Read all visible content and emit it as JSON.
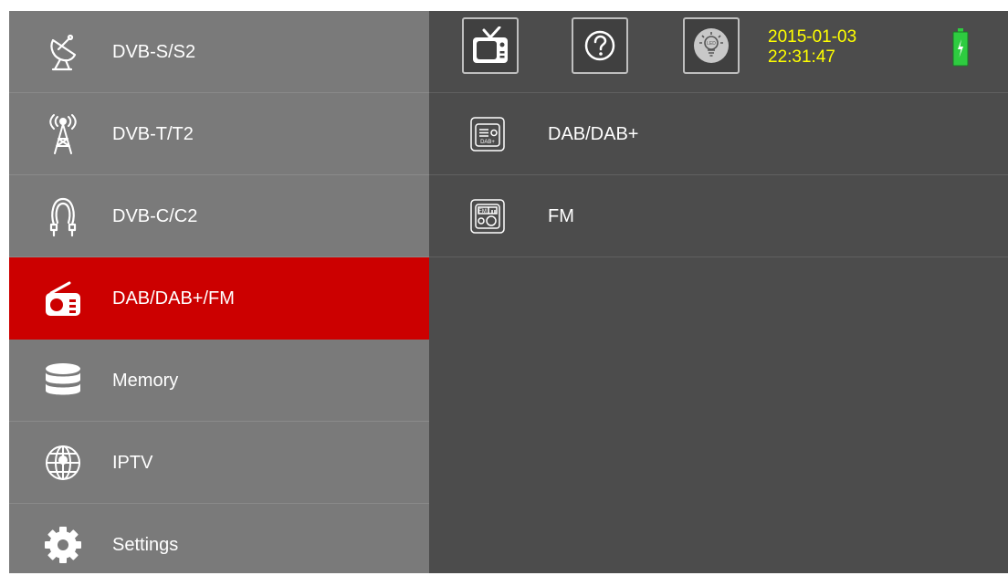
{
  "sidebar": {
    "items": [
      {
        "label": "DVB-S/S2",
        "icon": "satellite-dish-icon"
      },
      {
        "label": "DVB-T/T2",
        "icon": "antenna-tower-icon"
      },
      {
        "label": "DVB-C/C2",
        "icon": "cable-icon"
      },
      {
        "label": "DAB/DAB+/FM",
        "icon": "radio-icon",
        "active": true
      },
      {
        "label": "Memory",
        "icon": "database-icon"
      },
      {
        "label": "IPTV",
        "icon": "globe-icon"
      },
      {
        "label": "Settings",
        "icon": "gear-icon"
      }
    ]
  },
  "topbar": {
    "buttons": [
      {
        "icon": "tv-icon"
      },
      {
        "icon": "help-icon"
      },
      {
        "icon": "led-bulb-icon",
        "text": "LED"
      }
    ],
    "date": "2015-01-03",
    "time": "22:31:47",
    "battery_icon": "battery-charging-icon"
  },
  "main": {
    "items": [
      {
        "label": "DAB/DAB+",
        "icon": "dab-radio-icon",
        "icon_text": "DAB+"
      },
      {
        "label": "FM",
        "icon": "fm-radio-icon",
        "icon_text": "FM"
      }
    ]
  },
  "colors": {
    "active": "#cc0000",
    "sidebar": "#7a7a7a",
    "main_bg": "#4c4c4c",
    "datetime": "#ffff00",
    "battery": "#2ecc40"
  }
}
